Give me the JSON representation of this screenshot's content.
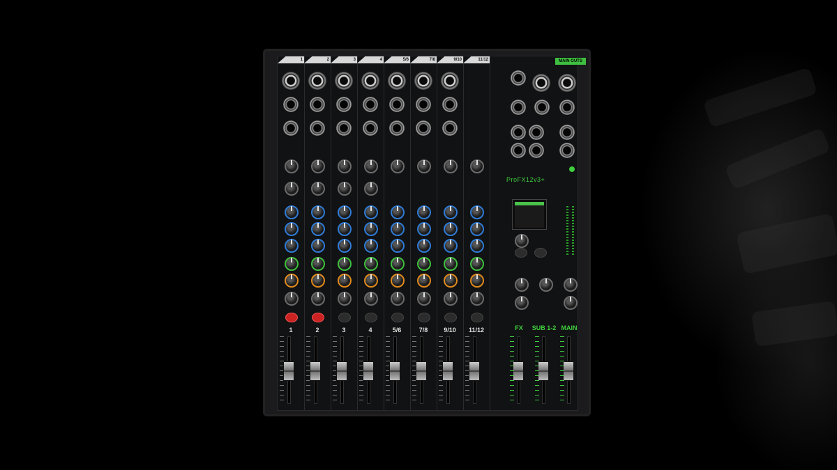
{
  "scene": {
    "description_visible_text": false
  },
  "mixer": {
    "brand_mark": "ProFX12v3+",
    "main_outs_label": "MAIN OUTS",
    "input_headers": [
      "1",
      "2",
      "3",
      "4",
      "5/6",
      "7/8",
      "9/10",
      "11/12"
    ],
    "channel_labels": [
      "1",
      "2",
      "3",
      "4",
      "5/6",
      "7/8",
      "9/10",
      "11/12"
    ],
    "master_labels": [
      "FX",
      "SUB 1-2",
      "MAIN"
    ],
    "colors": {
      "accent_green": "#3fbf3f",
      "eq_blue": "#2f7bd6",
      "mute_red": "#cc2222",
      "aux_orange": "#e08a1e"
    }
  }
}
